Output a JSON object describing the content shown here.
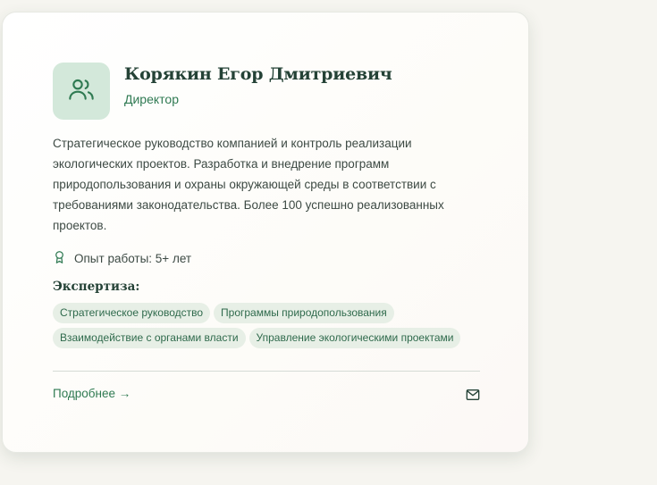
{
  "card": {
    "name": "Корякин Егор Дмитриевич",
    "role": "Директор",
    "bio": "Стратегическое руководство компанией и контроль реализации экологических проектов. Разработка и внедрение программ природопользования и охраны окружающей среды в соответствии с требованиями законодательства. Более 100 успешно реализованных проектов.",
    "experience": "Опыт работы: 5+ лет",
    "expertise_label": "Экспертиза:",
    "tags": [
      "Стратегическое руководство",
      "Программы природопользования",
      "Взаимодействие с органами власти",
      "Управление экологическими проектами"
    ],
    "more_link": "Подробнее →",
    "icons": {
      "avatar": "users-icon",
      "experience": "award-icon",
      "contact": "mail-icon"
    },
    "colors": {
      "accent": "#2f7a52",
      "title": "#244236",
      "avatar_bg": "#d3e8da",
      "tag_bg": "#e7efe6"
    }
  }
}
